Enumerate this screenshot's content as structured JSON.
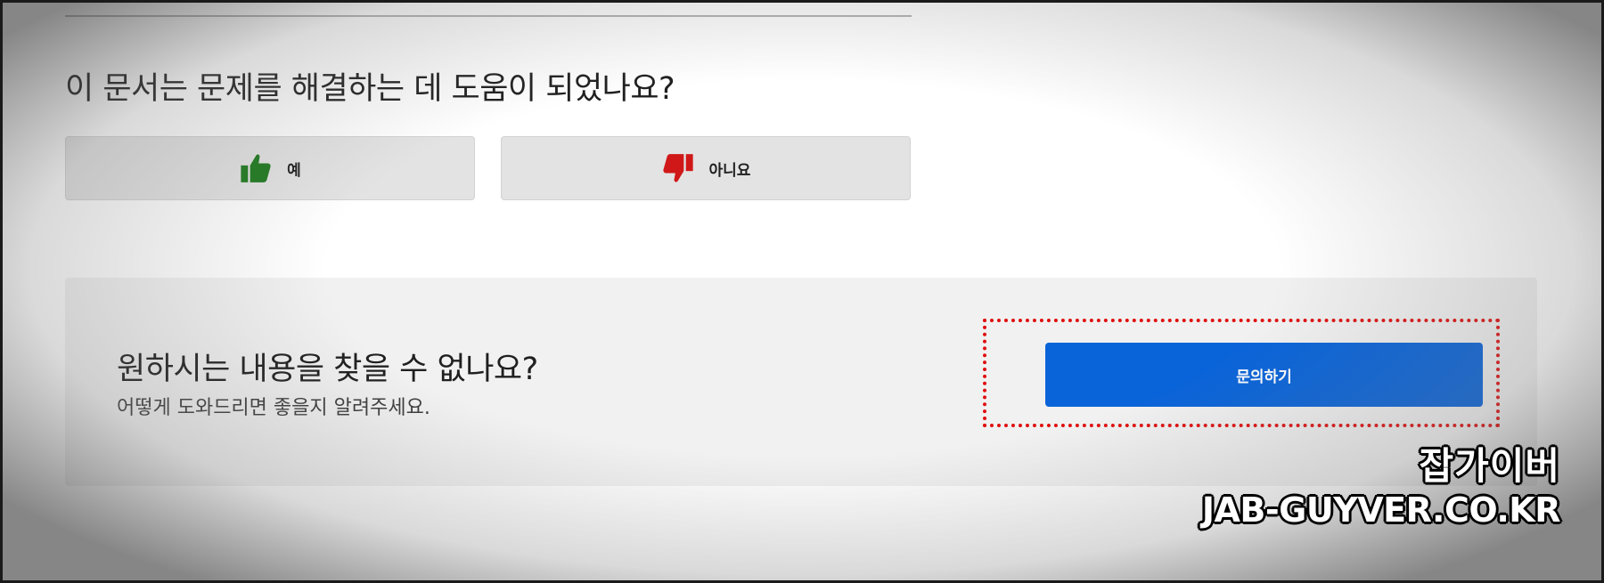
{
  "feedback": {
    "question": "이 문서는 문제를 해결하는 데 도움이 되었나요?",
    "yes_label": "예",
    "no_label": "아니요",
    "yes_icon": "thumbs-up-icon",
    "no_icon": "thumbs-down-icon",
    "yes_color": "#1e7a1e",
    "no_color": "#d01818"
  },
  "help": {
    "title": "원하시는 내용을 찾을 수 없나요?",
    "subtitle": "어떻게 도와드리면 좋을지 알려주세요.",
    "contact_label": "문의하기",
    "contact_color": "#0a64d9",
    "highlight_color": "#e01010"
  },
  "watermark": {
    "name": "잡가이버",
    "url": "JAB-GUYVER.CO.KR"
  }
}
